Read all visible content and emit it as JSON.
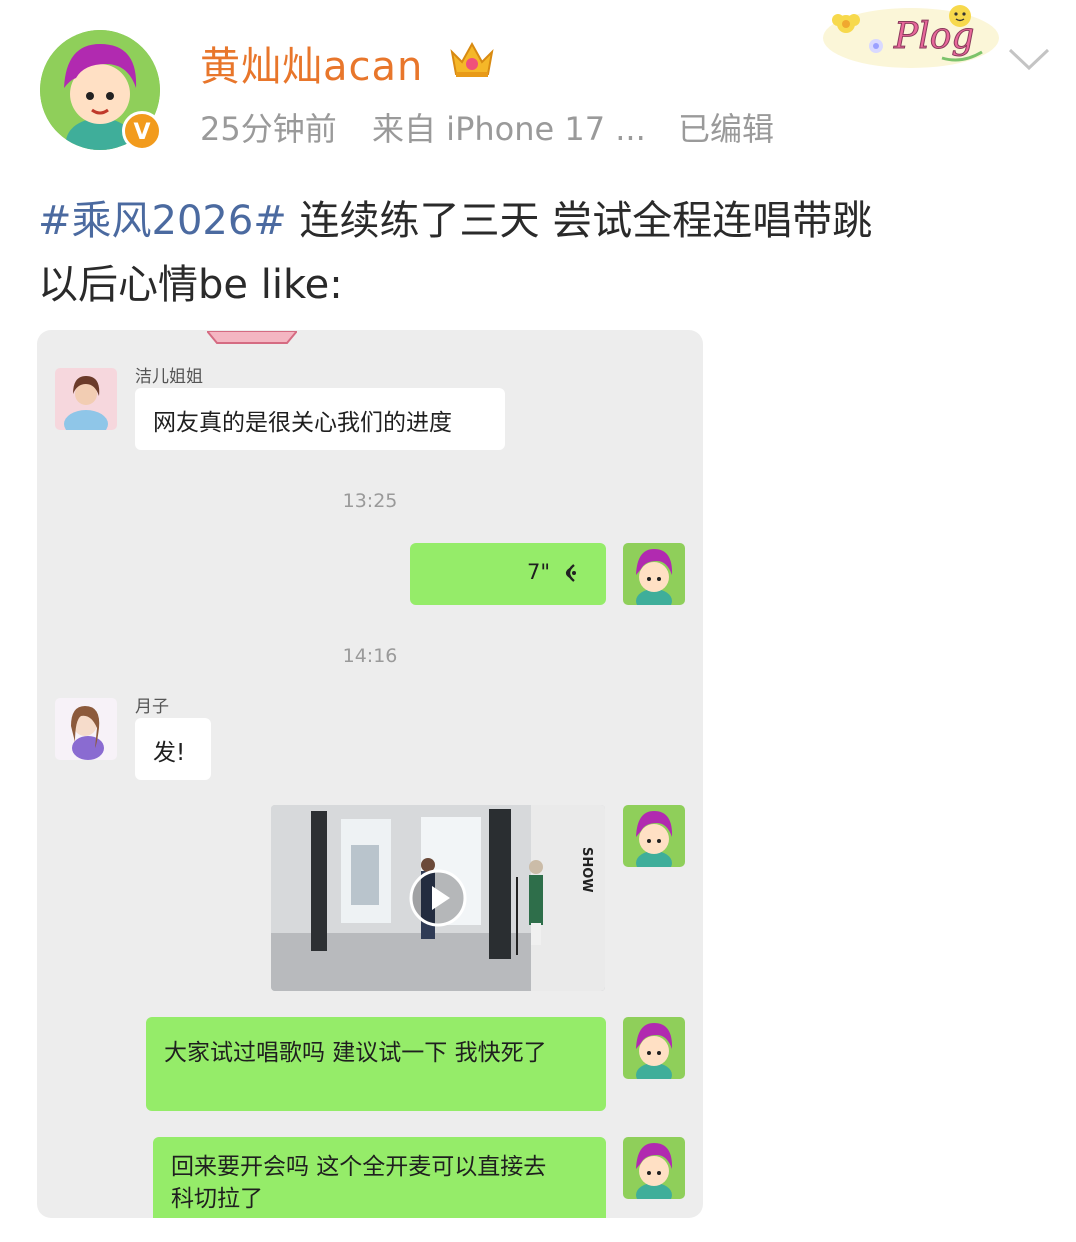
{
  "post": {
    "username": "黄灿灿acan",
    "time": "25分钟前",
    "source": "来自 iPhone 17 ...",
    "edited": "已编辑",
    "verified_badge": "V",
    "sticker_text": "Plog",
    "hashtag": "#乘风2026#",
    "text_line1": " 连续练了三天 尝试全程连唱带跳",
    "text_line2": "以后心情be like:"
  },
  "chat": {
    "messages": [
      {
        "sender": "洁儿姐姐",
        "text": "网友真的是很关心我们的进度"
      },
      {
        "timestamp": "13:25"
      },
      {
        "voice_duration": "7\""
      },
      {
        "timestamp": "14:16"
      },
      {
        "sender": "月子",
        "text": "发!"
      },
      {
        "video": true
      },
      {
        "text": "大家试过唱歌吗 建议试一下 我快死了"
      },
      {
        "text_line1": "回来要开会吗 这个全开麦可以直接去",
        "text_line2": "科切拉了"
      }
    ]
  },
  "icons": [
    "crown-icon",
    "chevron-down-icon",
    "voice-wave-icon",
    "play-icon",
    "verified-icon"
  ],
  "colors": {
    "username": "#e8762b",
    "hashtag": "#4b6aa0",
    "wechat_green": "#95ec69",
    "panel_bg": "#ededed"
  }
}
